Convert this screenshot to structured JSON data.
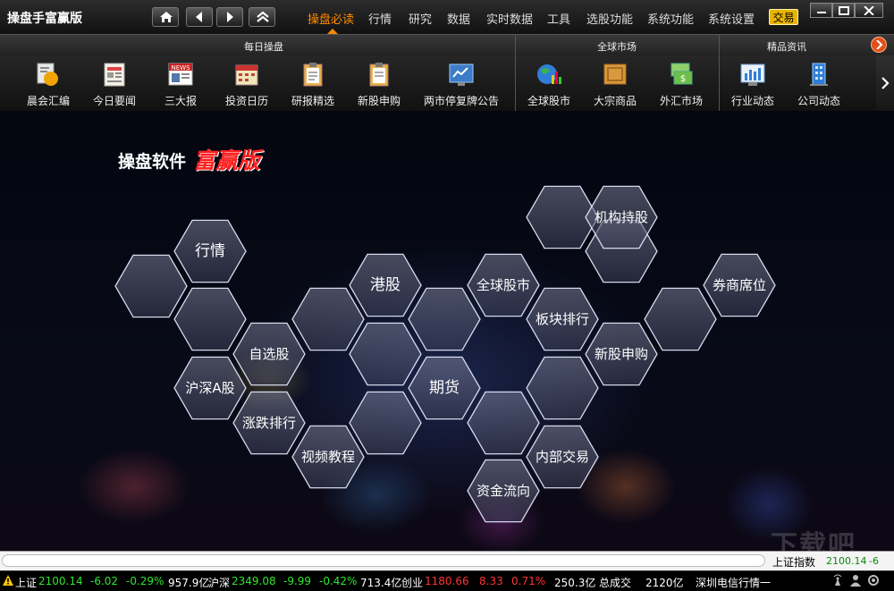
{
  "app": {
    "title": "操盘手富赢版"
  },
  "menu": [
    {
      "label": "操盘必读",
      "active": true
    },
    {
      "label": "行情",
      "active": false
    },
    {
      "label": "研究",
      "active": false
    },
    {
      "label": "数据",
      "active": false
    },
    {
      "label": "实时数据",
      "active": false
    },
    {
      "label": "工具",
      "active": false
    },
    {
      "label": "选股功能",
      "active": false
    },
    {
      "label": "系统功能",
      "active": false
    },
    {
      "label": "系统设置",
      "active": false
    }
  ],
  "trade_button": "交易",
  "sections": [
    "每日操盘",
    "全球市场",
    "精品资讯"
  ],
  "toolbar": [
    {
      "label": "晨会汇编",
      "icon": "meeting-icon"
    },
    {
      "label": "今日要闻",
      "icon": "newspaper-icon"
    },
    {
      "label": "三大报",
      "icon": "news-icon"
    },
    {
      "label": "投资日历",
      "icon": "calendar-icon"
    },
    {
      "label": "研报精选",
      "icon": "clipboard-icon"
    },
    {
      "label": "新股申购",
      "icon": "document-icon"
    },
    {
      "label": "两市停复牌公告",
      "icon": "announcement-icon"
    },
    {
      "label": "全球股市",
      "icon": "globe-chart-icon"
    },
    {
      "label": "大宗商品",
      "icon": "box-icon"
    },
    {
      "label": "外汇市场",
      "icon": "currency-icon"
    },
    {
      "label": "行业动态",
      "icon": "bar-chart-icon"
    },
    {
      "label": "公司动态",
      "icon": "building-icon"
    }
  ],
  "brand": {
    "text": "操盘软件",
    "highlight": "富赢版"
  },
  "hexes": [
    {
      "label": "行情"
    },
    {
      "label": "自选股"
    },
    {
      "label": "沪深A股"
    },
    {
      "label": "涨跌排行"
    },
    {
      "label": "视频教程"
    },
    {
      "label": "港股"
    },
    {
      "label": "期货"
    },
    {
      "label": "全球股市"
    },
    {
      "label": "板块排行"
    },
    {
      "label": "机构持股"
    },
    {
      "label": "新股申购"
    },
    {
      "label": "内部交易"
    },
    {
      "label": "资金流向"
    },
    {
      "label": "券商席位"
    }
  ],
  "index_strip": {
    "name": "上证指数",
    "value": "2100.14",
    "change": "-6"
  },
  "status": {
    "sh": {
      "name": "上证",
      "value": "2100.14",
      "change": "-6.02",
      "pct": "-0.29%",
      "amount": "957.9亿"
    },
    "sz": {
      "name": "沪深",
      "value": "2349.08",
      "change": "-9.99",
      "pct": "-0.42%",
      "amount": "713.4亿"
    },
    "cy": {
      "name": "创业",
      "value": "1180.66",
      "change": "8.33",
      "pct": "0.71%",
      "amount": "250.3亿"
    },
    "total_label": "总成交",
    "total_value": "2120亿",
    "server": "深圳电信行情一"
  },
  "watermark": "下载吧",
  "colors": {
    "accent": "#ff8a00",
    "up": "#ff3333",
    "down": "#2fe52f"
  }
}
